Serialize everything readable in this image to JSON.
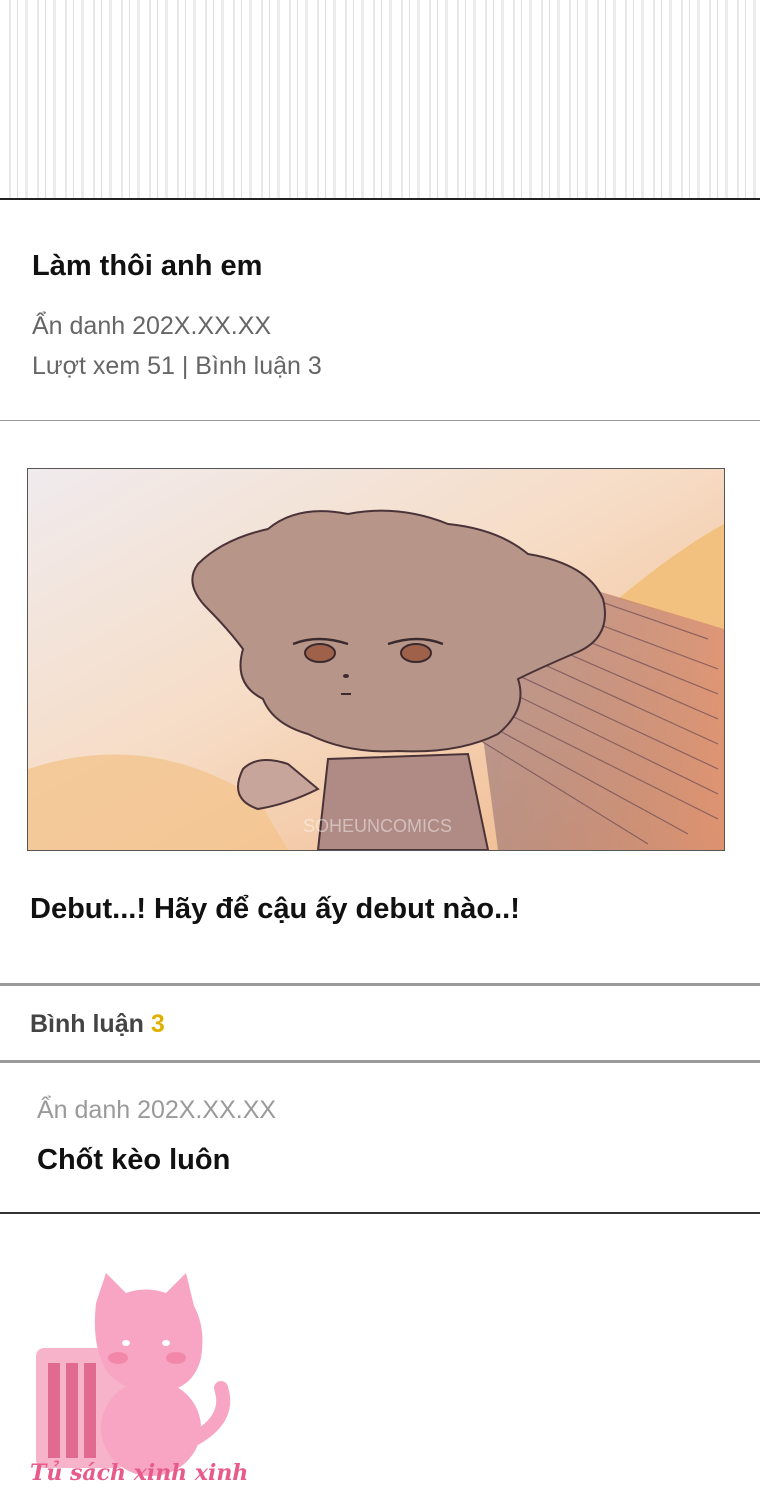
{
  "post": {
    "title": "Làm thôi anh em",
    "author_date": "Ẩn danh 202X.XX.XX",
    "stats": "Lượt xem 51 | Bình luận 3",
    "image_watermark": "SOHEUNCOMICS",
    "body": "Debut...! Hãy để cậu ấy debut nào..!"
  },
  "comments": {
    "label": "Bình luận",
    "count": "3",
    "items": [
      {
        "author_date": "Ẩn danh 202X.XX.XX",
        "text": "Chốt kèo luôn"
      }
    ]
  },
  "watermark": {
    "text": "Tủ sách xinh xinh"
  },
  "colors": {
    "accent_count": "#e0b000",
    "logo_pink": "#f28bb0"
  }
}
